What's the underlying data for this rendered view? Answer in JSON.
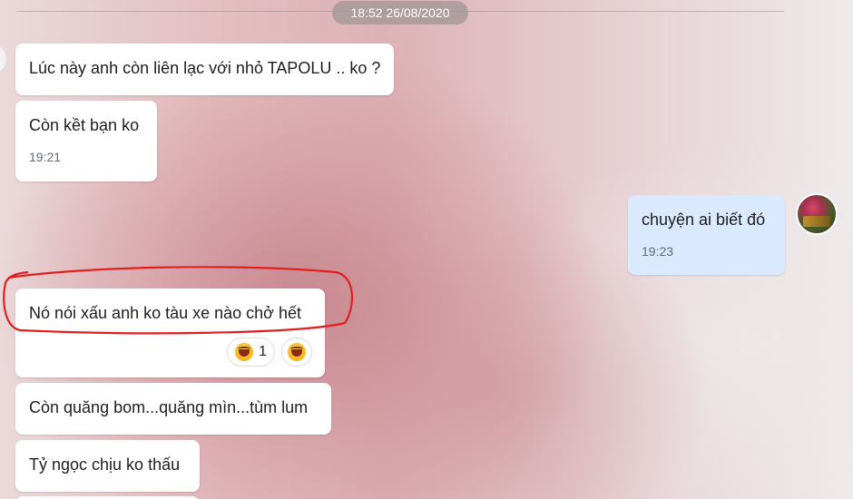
{
  "date_separator": "18:52 26/08/2020",
  "messages": [
    {
      "side": "in",
      "text": "Lúc này anh còn liên lạc với nhỏ TAPOLU .. ko ?",
      "time": ""
    },
    {
      "side": "in",
      "text": "Còn kềt bạn ko",
      "time": "19:21"
    },
    {
      "side": "out",
      "text": "chuyện ai biết đó",
      "time": "19:23"
    },
    {
      "side": "in",
      "text": "Nó nói xấu anh ko tàu xe nào chở hết",
      "time": ""
    },
    {
      "side": "in",
      "text": "Còn quăng bom...quăng mìn...tùm lum",
      "time": ""
    },
    {
      "side": "in",
      "text": "Tỷ ngọc chịu ko thấu",
      "time": ""
    }
  ],
  "reactions": {
    "count": "1",
    "reaction_icon": "laughing-emoji-icon",
    "add_icon": "laughing-emoji-icon"
  },
  "annotation": {
    "type": "hand-drawn-ellipse",
    "color": "#e02020"
  },
  "colors": {
    "incoming_bubble": "#ffffff",
    "outgoing_bubble": "#dbe9ff",
    "timestamp": "#5f6b75",
    "date_pill": "#a09696"
  }
}
